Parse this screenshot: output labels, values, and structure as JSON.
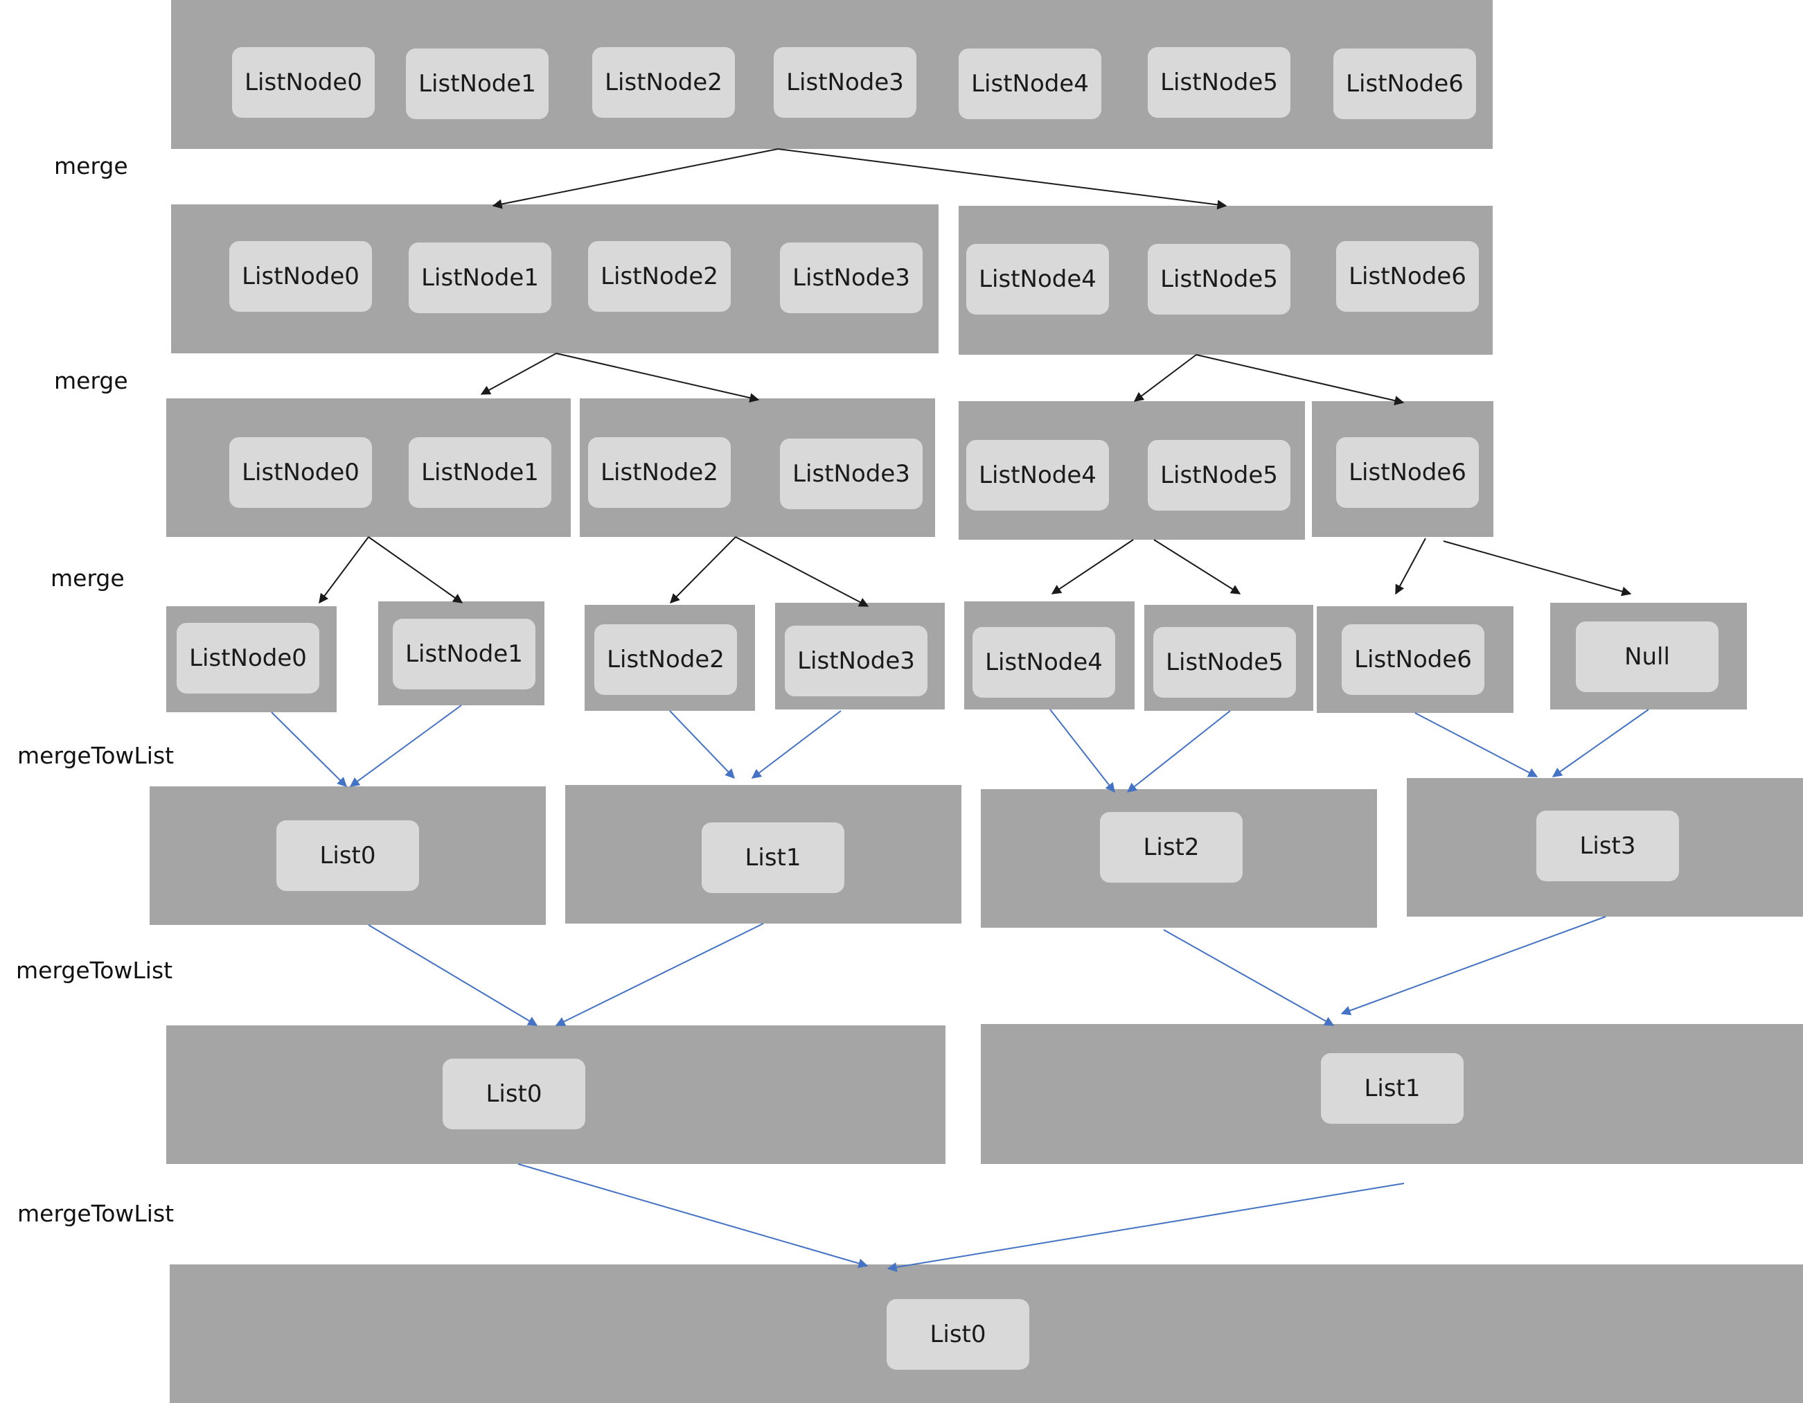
{
  "colors": {
    "group": "#a5a5a5",
    "node": "#d9d9d9",
    "merge_arrow": "#1a1a1a",
    "mergeTowList_arrow": "#4472c4"
  },
  "step_labels": [
    "merge",
    "merge",
    "merge",
    "mergeTowList",
    "mergeTowList",
    "mergeTowList"
  ],
  "level0": {
    "nodes": [
      "ListNode0",
      "ListNode1",
      "ListNode2",
      "ListNode3",
      "ListNode4",
      "ListNode5",
      "ListNode6"
    ]
  },
  "level1": {
    "left": [
      "ListNode0",
      "ListNode1",
      "ListNode2",
      "ListNode3"
    ],
    "right": [
      "ListNode4",
      "ListNode5",
      "ListNode6"
    ]
  },
  "level2": {
    "g0": [
      "ListNode0",
      "ListNode1"
    ],
    "g1": [
      "ListNode2",
      "ListNode3"
    ],
    "g2": [
      "ListNode4",
      "ListNode5"
    ],
    "g3": [
      "ListNode6"
    ]
  },
  "level3": {
    "nodes": [
      "ListNode0",
      "ListNode1",
      "ListNode2",
      "ListNode3",
      "ListNode4",
      "ListNode5",
      "ListNode6",
      "Null"
    ]
  },
  "level4": {
    "lists": [
      "List0",
      "List1",
      "List2",
      "List3"
    ]
  },
  "level5": {
    "lists": [
      "List0",
      "List1"
    ]
  },
  "level6": {
    "lists": [
      "List0"
    ]
  }
}
